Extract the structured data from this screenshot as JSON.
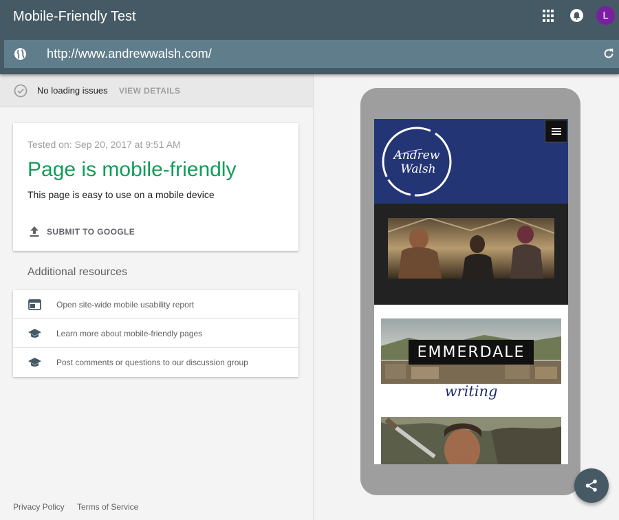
{
  "header": {
    "title": "Mobile-Friendly Test",
    "avatar_initial": "L",
    "icons": [
      "apps-grid-icon",
      "notifications-icon",
      "account-avatar"
    ]
  },
  "urlbar": {
    "url": "http://www.andrewwalsh.com/",
    "icons": [
      "globe-icon",
      "reload-icon"
    ]
  },
  "status": {
    "text": "No loading issues",
    "action": "VIEW DETAILS"
  },
  "result": {
    "tested_on": "Tested on: Sep 20, 2017 at 9:51 AM",
    "title": "Page is mobile-friendly",
    "description": "This page is easy to use on a mobile device",
    "submit_label": "SUBMIT TO GOOGLE"
  },
  "resources": {
    "title": "Additional resources",
    "items": [
      {
        "label": "Open site-wide mobile usability report",
        "icon": "web-window-icon"
      },
      {
        "label": "Learn more about mobile-friendly pages",
        "icon": "school-icon"
      },
      {
        "label": "Post comments or questions to our discussion group",
        "icon": "school-icon"
      }
    ]
  },
  "footer": {
    "privacy": "Privacy Policy",
    "terms": "Terms of Service"
  },
  "preview": {
    "logo_text": "Andrew Walsh",
    "banner_text": "EMMERDALE",
    "writing_text": "writing"
  },
  "colors": {
    "header_bg": "#455a64",
    "urlbar_bg": "#607d8b",
    "success": "#0f9d58",
    "avatar": "#7b1fa2",
    "site_header": "#243576"
  }
}
